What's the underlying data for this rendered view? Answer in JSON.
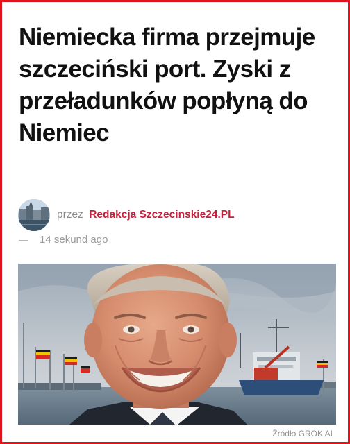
{
  "article": {
    "headline": "Niemiecka firma przejmuje szczeciński port. Zyski z przeładunków popłyną do Niemiec",
    "author_prefix": "przez",
    "author_name": "Redakcja Szczecinskie24.PL",
    "timestamp": "14 sekund ago",
    "image_caption": "Źródło GROK AI"
  },
  "colors": {
    "frame_border": "#e0141b",
    "author_link": "#c8203a",
    "headline_text": "#111111",
    "meta_text": "#8a8a8a"
  }
}
